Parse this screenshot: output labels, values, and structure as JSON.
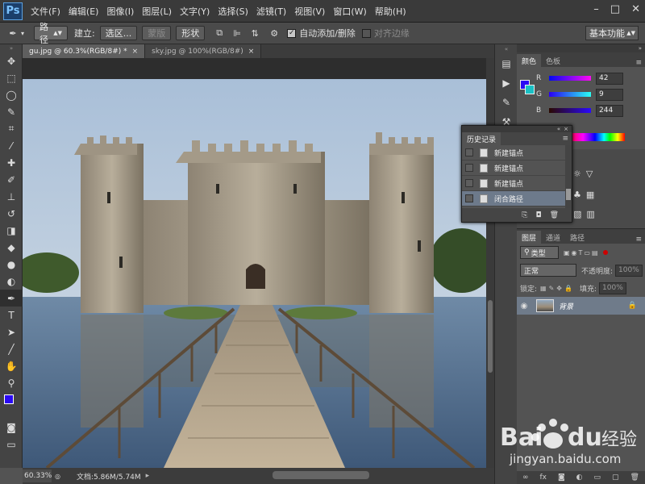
{
  "app": {
    "logo": "Ps"
  },
  "menu": [
    "文件(F)",
    "编辑(E)",
    "图像(I)",
    "图层(L)",
    "文字(Y)",
    "选择(S)",
    "滤镜(T)",
    "视图(V)",
    "窗口(W)",
    "帮助(H)"
  ],
  "window_controls": {
    "minimize": "–",
    "maximize": "□",
    "close": "✕"
  },
  "options_bar": {
    "tool_mode": "路径",
    "create_label": "建立:",
    "selection_btn": "选区...",
    "mask_btn": "蒙版",
    "shape_btn": "形状",
    "auto_add_delete": "自动添加/删除",
    "align_edges": "对齐边缘",
    "auto_add_checked": true,
    "workspace": "基本功能"
  },
  "doc_tabs": [
    {
      "label": "gu.jpg @ 60.3%(RGB/8#) *",
      "active": true
    },
    {
      "label": "sky.jpg @ 100%(RGB/8#)",
      "active": false
    }
  ],
  "status": {
    "zoom": "60.33%",
    "doc": "文档:5.86M/5.74M"
  },
  "color_panel": {
    "tabs": [
      "颜色",
      "色板"
    ],
    "r": "42",
    "g": "9",
    "b": "244",
    "fg_color": "#2a09f4",
    "bg_color": "#19c0c4",
    "labels": {
      "r": "R",
      "g": "G",
      "b": "B"
    }
  },
  "history_panel": {
    "tab": "历史记录",
    "items": [
      "新建锚点",
      "新建锚点",
      "新建锚点",
      "闭合路径"
    ],
    "selected_index": 3
  },
  "layers_panel": {
    "tabs": [
      "图层",
      "通道",
      "路径"
    ],
    "filter": "类型",
    "blend_mode": "正常",
    "opacity_label": "不透明度:",
    "opacity_value": "100%",
    "lock_label": "锁定:",
    "fill_label": "填充:",
    "fill_value": "100%",
    "layer_name": "背景"
  },
  "watermark": {
    "url": "jingyan.baidu.com"
  }
}
